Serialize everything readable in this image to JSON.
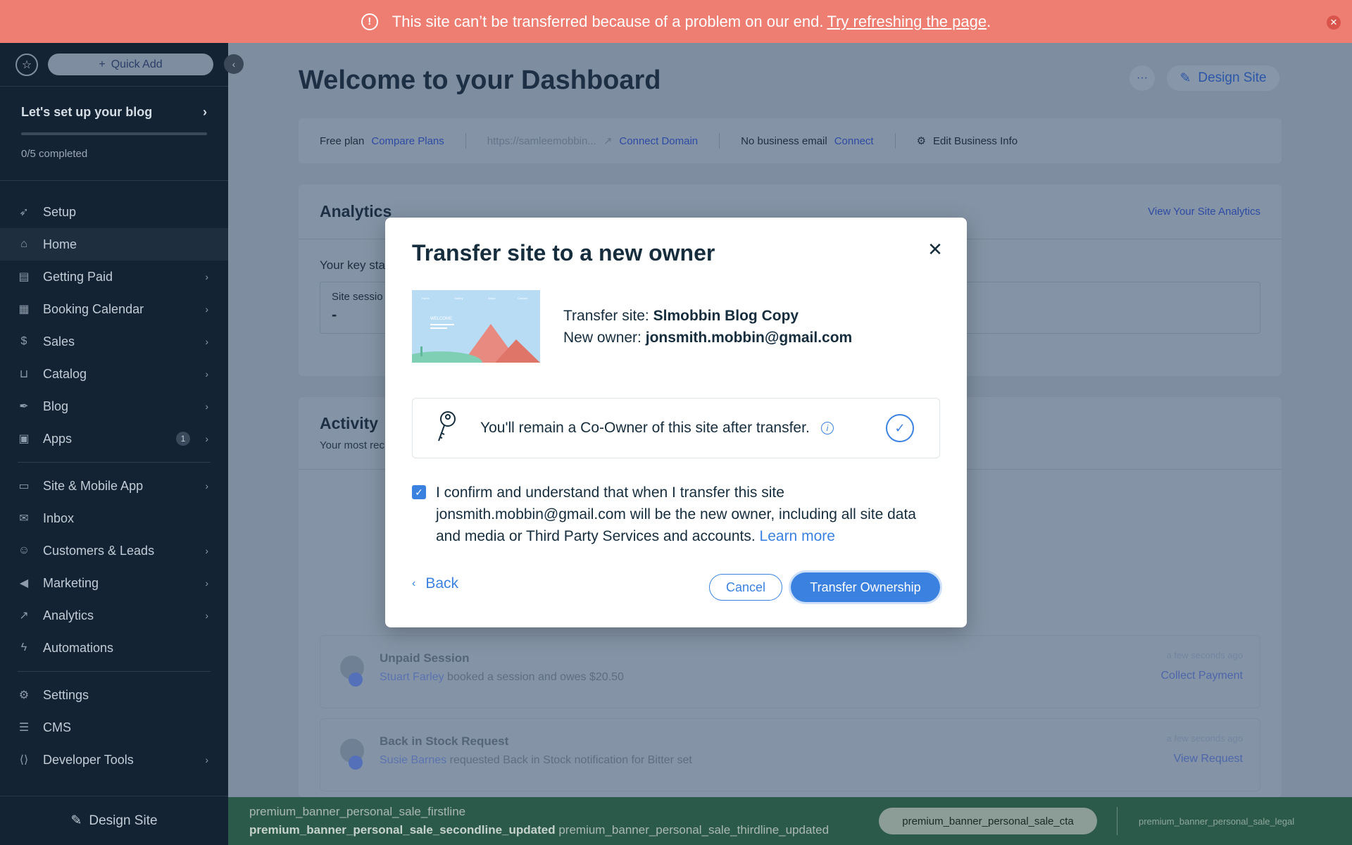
{
  "banner": {
    "message": "This site can’t be transferred because of a problem on our end.",
    "link": "Try refreshing the page",
    "end": "."
  },
  "sidebar": {
    "quick_add": "Quick Add",
    "setup_title": "Let's set up your blog",
    "setup_progress": 0,
    "setup_sub": "0/5 completed",
    "items": [
      {
        "label": "Setup",
        "icon": "rocket-icon"
      },
      {
        "label": "Home",
        "icon": "home-icon",
        "active": true
      },
      {
        "label": "Getting Paid",
        "icon": "invoice-icon",
        "chevron": true
      },
      {
        "label": "Booking Calendar",
        "icon": "calendar-icon",
        "chevron": true
      },
      {
        "label": "Sales",
        "icon": "dollar-icon",
        "chevron": true
      },
      {
        "label": "Catalog",
        "icon": "basket-icon",
        "chevron": true
      },
      {
        "label": "Blog",
        "icon": "pen-nib-icon",
        "chevron": true
      },
      {
        "label": "Apps",
        "icon": "apps-icon",
        "chevron": true,
        "badge": "1"
      },
      {
        "label": "Site & Mobile App",
        "icon": "devices-icon",
        "chevron": true
      },
      {
        "label": "Inbox",
        "icon": "inbox-icon"
      },
      {
        "label": "Customers & Leads",
        "icon": "people-icon",
        "chevron": true
      },
      {
        "label": "Marketing",
        "icon": "megaphone-icon",
        "chevron": true
      },
      {
        "label": "Analytics",
        "icon": "chart-icon",
        "chevron": true
      },
      {
        "label": "Automations",
        "icon": "bolt-icon"
      },
      {
        "label": "Settings",
        "icon": "gear-icon"
      },
      {
        "label": "CMS",
        "icon": "database-icon"
      },
      {
        "label": "Developer Tools",
        "icon": "code-icon",
        "chevron": true
      }
    ],
    "design_site": "Design Site"
  },
  "main": {
    "title": "Welcome to your Dashboard",
    "more": "···",
    "design_site": "Design Site",
    "info": {
      "plan": "Free plan",
      "compare": "Compare Plans",
      "url": "https://samleemobbin...",
      "connect_domain": "Connect Domain",
      "no_email": "No business email",
      "connect": "Connect",
      "edit": "Edit Business Info"
    },
    "analytics": {
      "title": "Analytics",
      "view_link": "View Your Site Analytics",
      "key_stats": "Your key sta",
      "stat_label": "Site sessio",
      "stat_value": "-"
    },
    "activity": {
      "title": "Activity",
      "sub": "Your most rec",
      "items": [
        {
          "title": "Unpaid Session",
          "name": "Stuart Farley",
          "desc": "booked a session and owes $20.50",
          "time": "a few seconds ago",
          "action": "Collect Payment"
        },
        {
          "title": "Back in Stock Request",
          "name": "Susie Barnes",
          "desc": "requested Back in Stock notification for Bitter set",
          "time": "a few seconds ago",
          "action": "View Request"
        }
      ]
    }
  },
  "promo": {
    "line1": "premium_banner_personal_sale_firstline",
    "line2": "premium_banner_personal_sale_secondline_updated",
    "line3": "premium_banner_personal_sale_thirdline_updated",
    "cta": "premium_banner_personal_sale_cta",
    "legal": "premium_banner_personal_sale_legal"
  },
  "modal": {
    "title": "Transfer site to a new owner",
    "transfer_site_label": "Transfer site:",
    "transfer_site_value": "Slmobbin Blog Copy",
    "new_owner_label": "New owner:",
    "new_owner_value": "jonsmith.mobbin@gmail.com",
    "thumb_welcome": "WELCOME",
    "thumb_nav": [
      "Home",
      "Gallery",
      "About",
      "Contact"
    ],
    "coowner_text": "You'll remain a Co-Owner of this site after transfer.",
    "confirm_text": "I confirm and understand that when I transfer this site jonsmith.mobbin@gmail.com will be the new owner, including all site data and media or Third Party Services and accounts.",
    "learn_more": "Learn more",
    "back": "Back",
    "cancel": "Cancel",
    "transfer": "Transfer Ownership",
    "accent": "#3b82e0"
  }
}
